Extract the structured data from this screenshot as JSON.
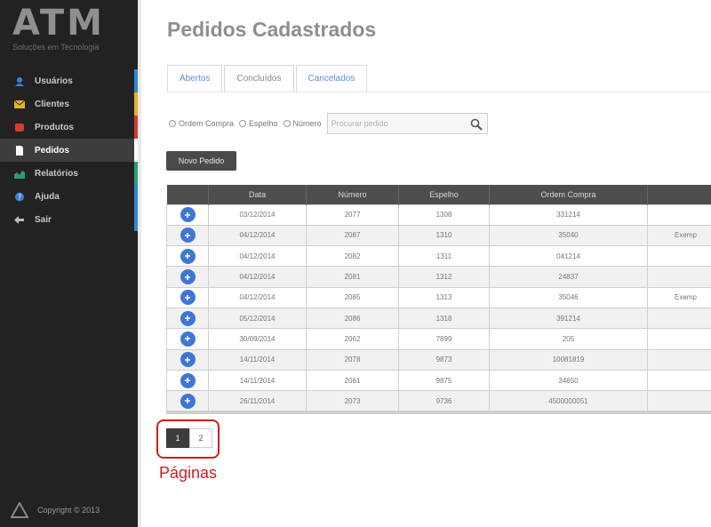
{
  "brand": {
    "logo": "ATM",
    "tagline": "Soluções em Tecnologia"
  },
  "sidebar": {
    "items": [
      {
        "label": "Usuários",
        "icon": "user-icon",
        "icon_color": "#3f7fd6",
        "accent": "#2f88d8"
      },
      {
        "label": "Clientes",
        "icon": "envelope-icon",
        "icon_color": "#e8b21a",
        "accent": "#e8b21a"
      },
      {
        "label": "Produtos",
        "icon": "box-icon",
        "icon_color": "#d83a2f",
        "accent": "#d83a2f"
      },
      {
        "label": "Pedidos",
        "icon": "document-icon",
        "icon_color": "#ffffff",
        "accent": "#ffffff",
        "active": true
      },
      {
        "label": "Relatórios",
        "icon": "chart-icon",
        "icon_color": "#2aa36a",
        "accent": "#2aa36a"
      },
      {
        "label": "Ajuda",
        "icon": "help-icon",
        "icon_color": "#3f7fd6",
        "accent": "#2f88d8"
      },
      {
        "label": "Sair",
        "icon": "exit-icon",
        "icon_color": "#bdbdbd",
        "accent": "#2f88d8"
      }
    ],
    "copyright": "Copyright © 2013"
  },
  "main": {
    "title": "Pedidos Cadastrados",
    "tabs": [
      {
        "label": "Abertos",
        "active": false
      },
      {
        "label": "Concluídos",
        "active": true
      },
      {
        "label": "Cancelados",
        "active": false
      }
    ],
    "filters": {
      "options": [
        "Ordem Compra",
        "Espelho",
        "Número"
      ],
      "search_placeholder": "Procurar pedido"
    },
    "new_button": "Novo Pedido",
    "table": {
      "columns": [
        "",
        "Data",
        "Número",
        "Espelho",
        "Ordem Compra",
        ""
      ],
      "rows": [
        {
          "data": "03/12/2014",
          "numero": "2077",
          "espelho": "1308",
          "ordem": "331214",
          "obs": ""
        },
        {
          "data": "04/12/2014",
          "numero": "2087",
          "espelho": "1310",
          "ordem": "35040",
          "obs": "Exemp"
        },
        {
          "data": "04/12/2014",
          "numero": "2082",
          "espelho": "1311",
          "ordem": "041214",
          "obs": ""
        },
        {
          "data": "04/12/2014",
          "numero": "2081",
          "espelho": "1312",
          "ordem": "24837",
          "obs": ""
        },
        {
          "data": "04/12/2014",
          "numero": "2085",
          "espelho": "1313",
          "ordem": "35046",
          "obs": "Exemp"
        },
        {
          "data": "05/12/2014",
          "numero": "2086",
          "espelho": "1318",
          "ordem": "391214",
          "obs": ""
        },
        {
          "data": "30/09/2014",
          "numero": "2062",
          "espelho": "7899",
          "ordem": "205",
          "obs": ""
        },
        {
          "data": "14/11/2014",
          "numero": "2078",
          "espelho": "9873",
          "ordem": "10081819",
          "obs": ""
        },
        {
          "data": "14/11/2014",
          "numero": "2061",
          "espelho": "9875",
          "ordem": "34650",
          "obs": ""
        },
        {
          "data": "26/11/2014",
          "numero": "2073",
          "espelho": "9736",
          "ordem": "4500000051",
          "obs": ""
        }
      ]
    },
    "pagination": {
      "pages": [
        "1",
        "2"
      ],
      "current": "1"
    },
    "annotation": "Páginas"
  },
  "colors": {
    "sidebar_bg": "#222222",
    "row_button": "#3f76d6",
    "annotation": "#cc1f1f"
  }
}
